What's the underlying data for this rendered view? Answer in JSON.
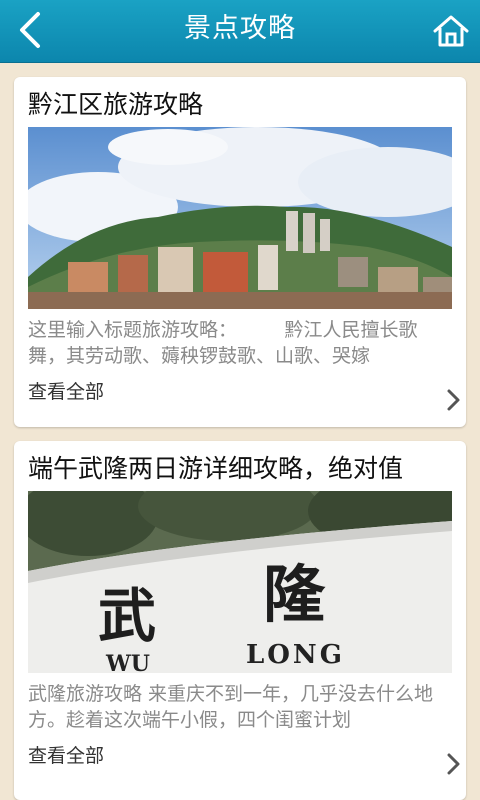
{
  "header": {
    "title": "景点攻略",
    "back_icon": "chevron-left-icon",
    "home_icon": "home-icon"
  },
  "articles": [
    {
      "title": "黔江区旅游攻略",
      "image": "city-panorama",
      "excerpt": "这里输入标题旅游攻略：　　　黔江人民擅长歌舞，其劳动歌、薅秧锣鼓歌、山歌、哭嫁",
      "more_label": "查看全部"
    },
    {
      "title": "端午武隆两日游详细攻略，绝对值",
      "image": "wulong-sign",
      "image_text_big_1": "武",
      "image_text_big_2": "隆",
      "image_text_small_1": "WU",
      "image_text_small_2": "LONG",
      "excerpt": "武隆旅游攻略 来重庆不到一年，几乎没去什么地方。趁着这次端午小假，四个闺蜜计划",
      "more_label": "查看全部"
    }
  ],
  "colors": {
    "header": "#1298bd",
    "background": "#f1e6d3",
    "excerpt": "#8a8a8a"
  }
}
